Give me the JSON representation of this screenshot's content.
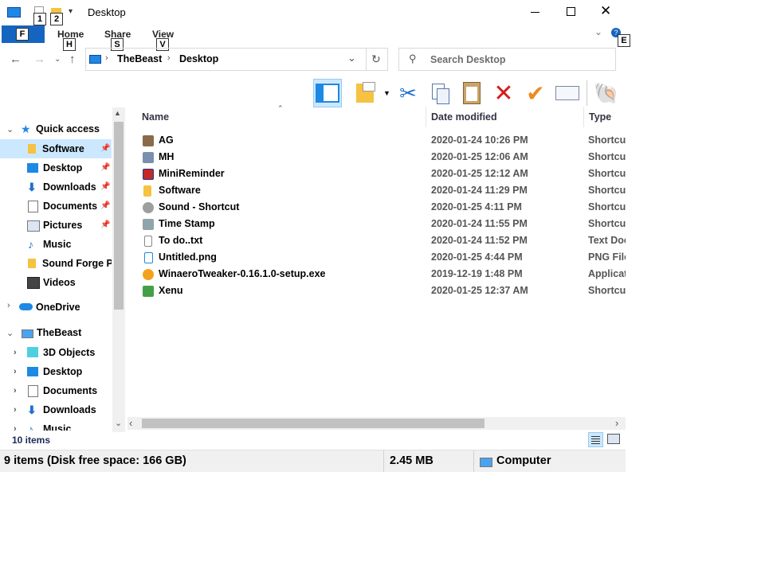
{
  "window": {
    "title": "Desktop"
  },
  "quick_access_toolbar": {
    "keytip_1": "1",
    "keytip_2": "2"
  },
  "ribbon": {
    "file_tab": "F",
    "tabs": [
      {
        "label": "Home",
        "keytip": "H"
      },
      {
        "label": "Share",
        "keytip": "S"
      },
      {
        "label": "View",
        "keytip": "V"
      }
    ],
    "help_keytip": "E"
  },
  "address_bar": {
    "crumbs": [
      "TheBeast",
      "Desktop"
    ]
  },
  "search": {
    "placeholder": "Search Desktop"
  },
  "nav_pane": {
    "quick_access": "Quick access",
    "quick_items": [
      "Software",
      "Desktop",
      "Downloads",
      "Documents",
      "Pictures",
      "Music",
      "Sound Forge P",
      "Videos"
    ],
    "onedrive": "OneDrive",
    "thisPC": "TheBeast",
    "pc_items": [
      "3D Objects",
      "Desktop",
      "Documents",
      "Downloads",
      "Music"
    ],
    "item_count": "10 items"
  },
  "columns": {
    "name": "Name",
    "date": "Date modified",
    "type": "Type"
  },
  "files": [
    {
      "name": "AG",
      "date": "2020-01-24 10:26 PM",
      "type": "Shortcut"
    },
    {
      "name": "MH",
      "date": "2020-01-25 12:06 AM",
      "type": "Shortcut"
    },
    {
      "name": "MiniReminder",
      "date": "2020-01-25 12:12 AM",
      "type": "Shortcut"
    },
    {
      "name": "Software",
      "date": "2020-01-24 11:29 PM",
      "type": "Shortcut"
    },
    {
      "name": "Sound - Shortcut",
      "date": "2020-01-25 4:11 PM",
      "type": "Shortcut"
    },
    {
      "name": "Time Stamp",
      "date": "2020-01-24 11:55 PM",
      "type": "Shortcut"
    },
    {
      "name": "To do..txt",
      "date": "2020-01-24 11:52 PM",
      "type": "Text Document"
    },
    {
      "name": "Untitled.png",
      "date": "2020-01-25 4:44 PM",
      "type": "PNG File"
    },
    {
      "name": "WinaeroTweaker-0.16.1.0-setup.exe",
      "date": "2019-12-19 1:48 PM",
      "type": "Application"
    },
    {
      "name": "Xenu",
      "date": "2020-01-25 12:37 AM",
      "type": "Shortcut"
    }
  ],
  "status": {
    "items": "9 items (Disk free space: 166 GB)",
    "size": "2.45 MB",
    "location": "Computer"
  },
  "colors": {
    "accent": "#1565c0",
    "selection": "#cce8ff",
    "folder": "#f5c242"
  }
}
